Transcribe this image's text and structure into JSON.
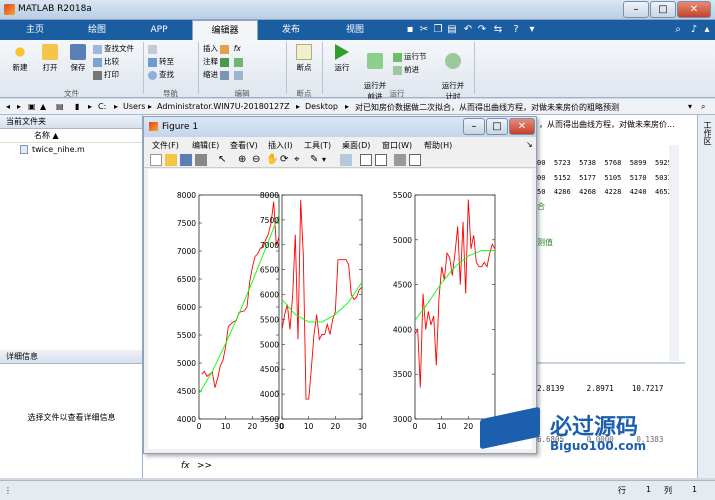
{
  "app": {
    "title": "MATLAB R2018a"
  },
  "tabs": [
    "主页",
    "绘图",
    "APP",
    "编辑器",
    "发布",
    "视图"
  ],
  "search": {
    "placeholder": "搜索文档"
  },
  "ribbon": {
    "file": {
      "new": "新建",
      "open": "打开",
      "save": "保存",
      "find_files": "查找文件",
      "compare": "比较",
      "print": "打印",
      "group": "文件"
    },
    "nav": {
      "goto": "转至",
      "find": "查找",
      "group": "导航"
    },
    "edit": {
      "insert": "插入",
      "comment": "注释",
      "indent": "缩进",
      "fx": "fx",
      "group": "编辑"
    },
    "breakpoint": {
      "label": "断点",
      "group": "断点"
    },
    "run": {
      "run": "运行",
      "run_advance": "运行并\n前进",
      "run_section": "运行节",
      "advance": "前进",
      "run_time": "运行并\n计时",
      "group": "运行"
    }
  },
  "address": {
    "segments": [
      "C:",
      "Users",
      "Administrator.WIN7U-20180127Z",
      "Desktop",
      "对已知房价数据做二次拟合，从而得出曲线方程，对做未来房价的粗略预测"
    ]
  },
  "left_panel": {
    "title": "当前文件夹",
    "col_name": "名称 ▲",
    "files": [
      "twice_nihe.m"
    ]
  },
  "detail_panel": {
    "title": "详细信息",
    "hint": "选择文件以查看详细信息"
  },
  "cmd": {
    "path_tail": "，从而得出曲线方程，对做未来房价...",
    "row1": "00  5723  5738  5768  5899  5925",
    "row2": "00  5152  5177  5105  5170  5033",
    "row3": "50  4286  4268  4228  4240  4652",
    "green1": "合",
    "green2": "测值",
    "res1": "2.8139     2.8971    10.7217",
    "res2": "6.6805     0.0000     0.1383",
    "prompt": ">>"
  },
  "figure": {
    "title": "Figure 1",
    "menu": [
      "文件(F)",
      "编辑(E)",
      "查看(V)",
      "插入(I)",
      "工具(T)",
      "桌面(D)",
      "窗口(W)",
      "帮助(H)"
    ]
  },
  "status": {
    "row_label": "行",
    "row": "1",
    "col_label": "列",
    "col": "1"
  },
  "right_strip": {
    "label": "工作区"
  },
  "watermark": {
    "brand": "必过源码",
    "url": "Biguo100.com"
  },
  "colors": {
    "tabstrip": "#1a5da1",
    "data": "#ff0000",
    "fit": "#00ff00"
  },
  "chart_data": [
    {
      "type": "line",
      "xlim": [
        0,
        30
      ],
      "ylim": [
        4000,
        8000
      ],
      "yticks": [
        4000,
        4500,
        5000,
        5500,
        6000,
        6500,
        7000,
        7500,
        8000
      ],
      "xticks": [
        0,
        10,
        20,
        30
      ],
      "series": [
        {
          "values": [
            [
              1,
              4800
            ],
            [
              2,
              4850
            ],
            [
              3,
              4760
            ],
            [
              4,
              4800
            ],
            [
              5,
              4840
            ],
            [
              6,
              4560
            ],
            [
              7,
              4730
            ],
            [
              8,
              4950
            ],
            [
              9,
              5050
            ],
            [
              10,
              5300
            ],
            [
              11,
              5650
            ],
            [
              12,
              5700
            ],
            [
              13,
              5740
            ],
            [
              14,
              5760
            ],
            [
              15,
              5900
            ],
            [
              16,
              5920
            ],
            [
              17,
              5930
            ],
            [
              18,
              6000
            ],
            [
              19,
              6450
            ],
            [
              20,
              6700
            ],
            [
              21,
              6900
            ],
            [
              22,
              6950
            ],
            [
              23,
              7050
            ],
            [
              24,
              7060
            ],
            [
              25,
              7200
            ],
            [
              26,
              7300
            ],
            [
              27,
              7500
            ],
            [
              28,
              7880
            ],
            [
              29,
              7100
            ],
            [
              30,
              7250
            ]
          ]
        },
        {
          "values": [
            [
              0,
              4450
            ],
            [
              5,
              4850
            ],
            [
              10,
              5350
            ],
            [
              15,
              5880
            ],
            [
              20,
              6450
            ],
            [
              25,
              7050
            ],
            [
              30,
              7650
            ]
          ]
        }
      ]
    },
    {
      "type": "line",
      "xlim": [
        0,
        30
      ],
      "ylim": [
        3500,
        8000
      ],
      "yticks": [
        3500,
        4000,
        4500,
        5000,
        5500,
        6000,
        6500,
        7000,
        7500,
        8000
      ],
      "xticks": [
        0,
        10,
        20,
        30
      ],
      "series": [
        {
          "values": [
            [
              0,
              5300
            ],
            [
              1,
              5600
            ],
            [
              2,
              5800
            ],
            [
              3,
              5300
            ],
            [
              4,
              6000
            ],
            [
              5,
              7200
            ],
            [
              6,
              5100
            ],
            [
              7,
              7900
            ],
            [
              8,
              6800
            ],
            [
              9,
              3900
            ],
            [
              10,
              3900
            ],
            [
              11,
              4500
            ],
            [
              12,
              5200
            ],
            [
              13,
              5600
            ],
            [
              14,
              5100
            ],
            [
              15,
              5200
            ],
            [
              16,
              5200
            ],
            [
              17,
              5400
            ],
            [
              18,
              5200
            ],
            [
              19,
              5500
            ],
            [
              20,
              5650
            ],
            [
              21,
              6700
            ],
            [
              22,
              6700
            ],
            [
              23,
              6700
            ],
            [
              24,
              6700
            ],
            [
              25,
              6600
            ],
            [
              26,
              6000
            ],
            [
              27,
              5900
            ],
            [
              28,
              5950
            ],
            [
              29,
              6100
            ],
            [
              30,
              6150
            ]
          ]
        },
        {
          "values": [
            [
              0,
              5900
            ],
            [
              5,
              5600
            ],
            [
              10,
              5450
            ],
            [
              15,
              5450
            ],
            [
              20,
              5600
            ],
            [
              25,
              5850
            ],
            [
              30,
              6250
            ]
          ]
        }
      ]
    },
    {
      "type": "line",
      "xlim": [
        0,
        30
      ],
      "ylim": [
        3000,
        5500
      ],
      "yticks": [
        3000,
        3500,
        4000,
        4500,
        5000,
        5500
      ],
      "xticks": [
        0,
        10,
        20,
        30
      ],
      "series": [
        {
          "values": [
            [
              0,
              3950
            ],
            [
              1,
              4000
            ],
            [
              2,
              3350
            ],
            [
              3,
              4400
            ],
            [
              4,
              4000
            ],
            [
              5,
              4200
            ],
            [
              6,
              4050
            ],
            [
              7,
              4150
            ],
            [
              8,
              3600
            ],
            [
              9,
              4350
            ],
            [
              10,
              4700
            ],
            [
              11,
              4550
            ],
            [
              12,
              4850
            ],
            [
              13,
              4800
            ],
            [
              14,
              4600
            ],
            [
              15,
              4850
            ],
            [
              16,
              5150
            ],
            [
              17,
              4500
            ],
            [
              18,
              5200
            ],
            [
              19,
              4400
            ],
            [
              20,
              5450
            ],
            [
              21,
              4900
            ],
            [
              22,
              5050
            ],
            [
              23,
              4750
            ],
            [
              24,
              4700
            ],
            [
              25,
              4700
            ],
            [
              26,
              4750
            ],
            [
              27,
              4700
            ],
            [
              28,
              4850
            ],
            [
              29,
              4950
            ],
            [
              30,
              4900
            ]
          ]
        },
        {
          "values": [
            [
              0,
              4100
            ],
            [
              5,
              4300
            ],
            [
              10,
              4520
            ],
            [
              15,
              4700
            ],
            [
              20,
              4820
            ],
            [
              25,
              4880
            ],
            [
              30,
              4880
            ]
          ]
        }
      ]
    }
  ]
}
